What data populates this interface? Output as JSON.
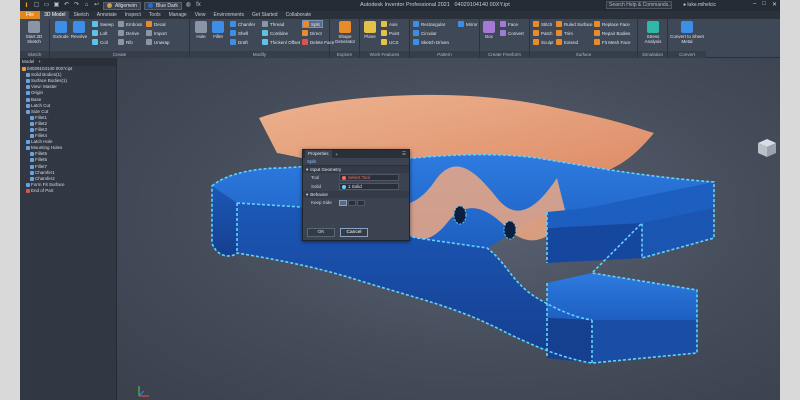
{
  "window": {
    "app_title": "Autodesk Inventor Professional 2021",
    "doc_title": "04029104140 00XY.ipt",
    "search_placeholder": "Search Help & Commands...",
    "user": "luke.mihelcic",
    "material": "Allgemein",
    "appearance": "Blue Dark",
    "qat_fx": "fx"
  },
  "tabs": [
    "File",
    "3D Model",
    "Sketch",
    "Annotate",
    "Inspect",
    "Tools",
    "Manage",
    "View",
    "Environments",
    "Get Started",
    "Collaborate"
  ],
  "ribbon": {
    "sketch": {
      "start_label": "Start 2D Sketch",
      "title": "Sketch"
    },
    "create": {
      "extrude": "Extrude",
      "revolve": "Revolve",
      "sweep": "Sweep",
      "loft": "Loft",
      "coil": "Coil",
      "emboss": "Emboss",
      "derive": "Derive",
      "rib": "Rib",
      "decal": "Decal",
      "import": "Import",
      "unwrap": "Unwrap",
      "title": "Create"
    },
    "modify": {
      "hole": "Hole",
      "fillet": "Fillet",
      "chamfer": "Chamfer",
      "shell": "Shell",
      "draft": "Draft",
      "thread": "Thread",
      "combine": "Combine",
      "thicken": "Thicken/ Offset",
      "split": "Split",
      "direct": "Direct",
      "delete_face": "Delete Face",
      "title": "Modify"
    },
    "explore": {
      "shape_generator": "Shape Generator",
      "title": "Explore"
    },
    "work_features": {
      "plane": "Plane",
      "axis": "Axis",
      "point": "Point",
      "ucs": "UCS",
      "title": "Work Features"
    },
    "pattern": {
      "rectangular": "Rectangular",
      "circular": "Circular",
      "sketch_driven": "Sketch Driven",
      "mirror": "Mirror",
      "title": "Pattern"
    },
    "freeform": {
      "box": "Box",
      "face": "Face",
      "convert": "Convert",
      "title": "Create Freeform"
    },
    "surface": {
      "stitch": "Stitch",
      "patch": "Patch",
      "sculpt": "Sculpt",
      "ruled_surface": "Ruled Surface",
      "trim": "Trim",
      "extend": "Extend",
      "replace_face": "Replace Face",
      "repair_bodies": "Repair Bodies",
      "fit_mesh_face": "Fit Mesh Face",
      "title": "Surface"
    },
    "simulation": {
      "stress": "Stress Analysis",
      "title": "Simulation"
    },
    "convert": {
      "sheet_metal": "Convert to Sheet Metal",
      "title": "Convert"
    }
  },
  "browser": {
    "tab_model": "Model",
    "plus": "+",
    "items": [
      {
        "label": "04029104140 00XY.ipt",
        "indent": 0,
        "kind": "part"
      },
      {
        "label": "Solid Bodies(1)",
        "indent": 1,
        "kind": "feat"
      },
      {
        "label": "Surface Bodies(1)",
        "indent": 1,
        "kind": "feat"
      },
      {
        "label": "View: Master",
        "indent": 1,
        "kind": "feat"
      },
      {
        "label": "Origin",
        "indent": 1,
        "kind": "feat"
      },
      {
        "label": "Base",
        "indent": 1,
        "kind": "feat"
      },
      {
        "label": "Latch Cut",
        "indent": 1,
        "kind": "feat"
      },
      {
        "label": "Side Cut",
        "indent": 1,
        "kind": "feat"
      },
      {
        "label": "Fillet1",
        "indent": 2,
        "kind": "feat"
      },
      {
        "label": "Fillet2",
        "indent": 2,
        "kind": "feat"
      },
      {
        "label": "Fillet3",
        "indent": 2,
        "kind": "feat"
      },
      {
        "label": "Fillet4",
        "indent": 2,
        "kind": "feat"
      },
      {
        "label": "Latch Hole",
        "indent": 1,
        "kind": "feat"
      },
      {
        "label": "Mounting Holes",
        "indent": 1,
        "kind": "feat"
      },
      {
        "label": "Fillet5",
        "indent": 2,
        "kind": "feat"
      },
      {
        "label": "Fillet6",
        "indent": 2,
        "kind": "feat"
      },
      {
        "label": "Fillet7",
        "indent": 2,
        "kind": "feat"
      },
      {
        "label": "Chamfer1",
        "indent": 2,
        "kind": "feat"
      },
      {
        "label": "Chamfer2",
        "indent": 2,
        "kind": "feat"
      },
      {
        "label": "Form Fit Surface",
        "indent": 1,
        "kind": "feat"
      },
      {
        "label": "End of Part",
        "indent": 1,
        "kind": "end"
      }
    ]
  },
  "properties": {
    "title": "Properties",
    "plus": "+",
    "menu": "☰",
    "feature": "Split",
    "section_input": "Input Geometry",
    "tool_label": "Tool",
    "tool_value": "Select Tool",
    "solid_label": "Solid",
    "solid_value": "1 Solid",
    "section_behavior": "Behavior",
    "keep_side_label": "Keep Side",
    "ok": "OK",
    "cancel": "Cancel"
  },
  "colors": {
    "accent": "#e0871f",
    "part_fill": "#1e63c8",
    "selection": "#5fd3ff",
    "surface": "#f2a77e"
  }
}
